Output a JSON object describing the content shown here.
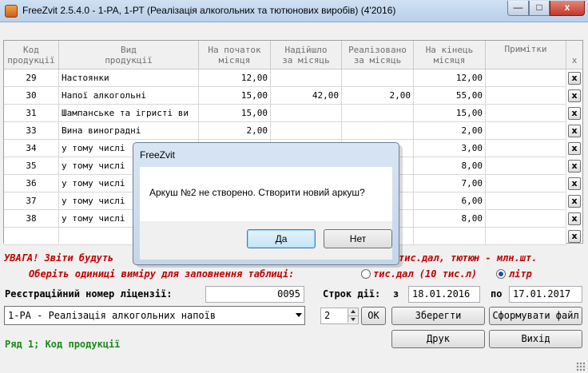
{
  "window": {
    "title": "FreeZvit 2.5.4.0 - 1-РА, 1-РТ (Реалізація алкогольних та тютюнових виробів) (4'2016)",
    "min_glyph": "—",
    "max_glyph": "□",
    "close_glyph": "x"
  },
  "table": {
    "headers": [
      "Код\nпродукції",
      "Вид\nпродукції",
      "На початок\nмісяця",
      "Надійшло\nза місяць",
      "Реалізовано\nза місяць",
      "На кінець\nмісяця",
      "Примітки",
      "x"
    ],
    "rows": [
      {
        "code": "29",
        "name": "Настоянки",
        "start": "12,00",
        "in": "",
        "sold": "",
        "end": "12,00",
        "note": ""
      },
      {
        "code": "30",
        "name": "Напої алкогольні",
        "start": "15,00",
        "in": "42,00",
        "sold": "2,00",
        "end": "55,00",
        "note": ""
      },
      {
        "code": "31",
        "name": "Шампанське та ігристі ви",
        "start": "15,00",
        "in": "",
        "sold": "",
        "end": "15,00",
        "note": ""
      },
      {
        "code": "33",
        "name": "Вина виноградні",
        "start": "2,00",
        "in": "",
        "sold": "",
        "end": "2,00",
        "note": ""
      },
      {
        "code": "34",
        "name": "у тому числі",
        "start": "",
        "in": "",
        "sold": "",
        "end": "3,00",
        "note": ""
      },
      {
        "code": "35",
        "name": "у тому числі",
        "start": "",
        "in": "",
        "sold": "",
        "end": "8,00",
        "note": ""
      },
      {
        "code": "36",
        "name": "у тому числі",
        "start": "",
        "in": "",
        "sold": "",
        "end": "7,00",
        "note": ""
      },
      {
        "code": "37",
        "name": "у тому числі",
        "start": "",
        "in": "",
        "sold": "",
        "end": "6,00",
        "note": ""
      },
      {
        "code": "38",
        "name": "у тому числі",
        "start": "",
        "in": "",
        "sold": "",
        "end": "8,00",
        "note": ""
      },
      {
        "code": "",
        "name": "",
        "start": "",
        "in": "",
        "sold": "",
        "end": "",
        "note": ""
      }
    ],
    "delete_label": "x"
  },
  "footer": {
    "warning_start": "УВАГА! Звіти будуть",
    "warning_end": "тис.дал, тютюн - млн.шт.",
    "units_prompt": "Оберіть одиниці виміру для заповнення таблиці:",
    "unit_option_1": "тис.дал (10 тис.л)",
    "unit_option_2": "літр",
    "selected_unit": "літр",
    "license_label": "Реєстраційний номер ліцензії:",
    "license_value": "0095",
    "term_label": "Строк дії:",
    "from_label": "з",
    "from_date": "18.01.2016",
    "to_label": "по",
    "to_date": "17.01.2017",
    "report_select": "1-РА - Реалізація алкогольних напоїв",
    "sheet_number": "2",
    "ok_label": "OK",
    "save_label": "Зберегти",
    "make_file_label": "Сформувати файл",
    "print_label": "Друк",
    "exit_label": "Вихід",
    "status": "Ряд 1; Код продукції"
  },
  "dialog": {
    "title": "FreeZvit",
    "message": "Аркуш №2 не створено. Створити новий аркуш?",
    "yes_label": "Да",
    "no_label": "Нет"
  }
}
